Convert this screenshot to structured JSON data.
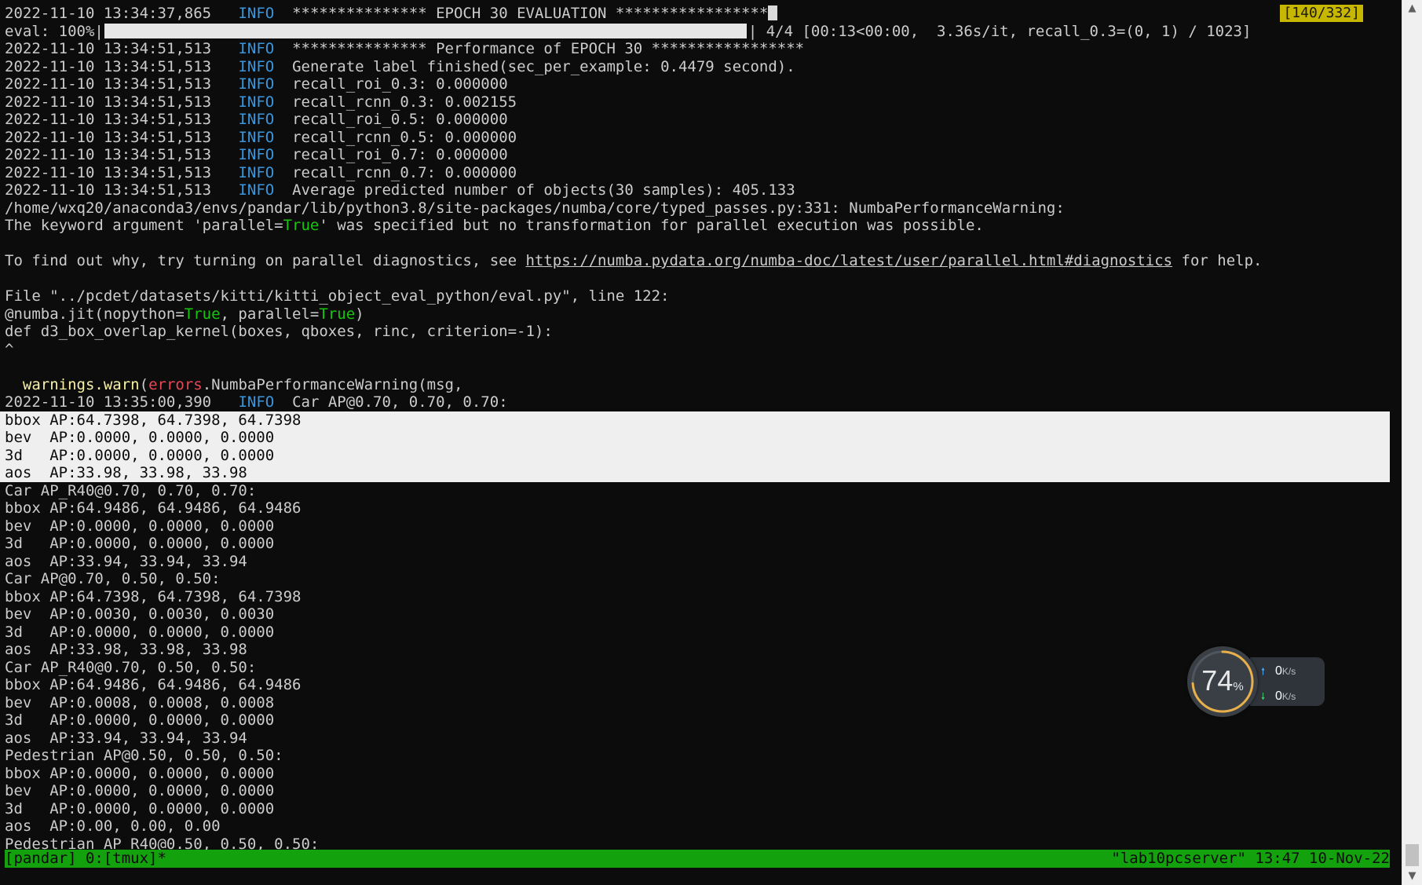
{
  "terminal": {
    "counter": "[140/332]",
    "lines": [
      {
        "t": "2022-11-10 13:34:37,865 ",
        "lvl": "INFO",
        "msg": "*************** EPOCH 30 EVALUATION *****************"
      },
      {
        "eval_prefix": "eval: 100%|",
        "eval_suffix": "| 4/4 [00:13<00:00,  3.36s/it, recall_0.3=(0, 1) / 1023]",
        "progress": 1.0
      },
      {
        "t": "2022-11-10 13:34:51,513 ",
        "lvl": "INFO",
        "msg": "*************** Performance of EPOCH 30 *****************"
      },
      {
        "t": "2022-11-10 13:34:51,513 ",
        "lvl": "INFO",
        "msg": "Generate label finished(sec_per_example: 0.4479 second)."
      },
      {
        "t": "2022-11-10 13:34:51,513 ",
        "lvl": "INFO",
        "msg": "recall_roi_0.3: 0.000000"
      },
      {
        "t": "2022-11-10 13:34:51,513 ",
        "lvl": "INFO",
        "msg": "recall_rcnn_0.3: 0.002155"
      },
      {
        "t": "2022-11-10 13:34:51,513 ",
        "lvl": "INFO",
        "msg": "recall_roi_0.5: 0.000000"
      },
      {
        "t": "2022-11-10 13:34:51,513 ",
        "lvl": "INFO",
        "msg": "recall_rcnn_0.5: 0.000000"
      },
      {
        "t": "2022-11-10 13:34:51,513 ",
        "lvl": "INFO",
        "msg": "recall_roi_0.7: 0.000000"
      },
      {
        "t": "2022-11-10 13:34:51,513 ",
        "lvl": "INFO",
        "msg": "recall_rcnn_0.7: 0.000000"
      },
      {
        "t": "2022-11-10 13:34:51,513 ",
        "lvl": "INFO",
        "msg": "Average predicted number of objects(30 samples): 405.133"
      },
      {
        "text": "/home/wxq20/anaconda3/envs/pandar/lib/python3.8/site-packages/numba/core/typed_passes.py:331: NumbaPerformanceWarning:"
      },
      {
        "parts": [
          [
            "The keyword argument 'parallel=",
            ""
          ],
          [
            "True",
            "green"
          ],
          [
            "' was specified but no transformation for parallel execution was possible.",
            ""
          ]
        ]
      },
      {
        "text": ""
      },
      {
        "parts": [
          [
            "To find out why, try turning on parallel diagnostics, see ",
            ""
          ],
          [
            "https://numba.pydata.org/numba-doc/latest/user/parallel.html#diagnostics",
            "link"
          ],
          [
            " for help.",
            ""
          ]
        ]
      },
      {
        "text": ""
      },
      {
        "text": "File \"../pcdet/datasets/kitti/kitti_object_eval_python/eval.py\", line 122:"
      },
      {
        "parts": [
          [
            "@numba.jit(nopython=",
            ""
          ],
          [
            "True",
            "green"
          ],
          [
            ", parallel=",
            ""
          ],
          [
            "True",
            "green"
          ],
          [
            ")",
            ""
          ]
        ]
      },
      {
        "text": "def d3_box_overlap_kernel(boxes, qboxes, rinc, criterion=-1):"
      },
      {
        "text": "^"
      },
      {
        "text": ""
      },
      {
        "parts": [
          [
            "  ",
            ""
          ],
          [
            "warnings.warn",
            "yellow"
          ],
          [
            "(",
            ""
          ],
          [
            "errors",
            "red"
          ],
          [
            ".NumbaPerformanceWarning(msg,",
            ""
          ]
        ]
      },
      {
        "t": "2022-11-10 13:35:00,390 ",
        "lvl": "INFO",
        "msg": "Car AP@0.70, 0.70, 0.70:"
      },
      {
        "parts": [
          [
            "bbox AP:",
            ""
          ],
          [
            "64.7398, 64.7398, 64.7398",
            "hi"
          ]
        ],
        "selected": true
      },
      {
        "text": "bev  AP:0.0000, 0.0000, 0.0000",
        "selected": true
      },
      {
        "text": "3d   AP:0.0000, 0.0000, 0.0000",
        "selected": true
      },
      {
        "text": "aos  AP:33.98, 33.98, 33.98",
        "selected": true
      },
      {
        "text": "Car AP_R40@0.70, 0.70, 0.70:"
      },
      {
        "text": "bbox AP:64.9486, 64.9486, 64.9486"
      },
      {
        "text": "bev  AP:0.0000, 0.0000, 0.0000"
      },
      {
        "text": "3d   AP:0.0000, 0.0000, 0.0000"
      },
      {
        "text": "aos  AP:33.94, 33.94, 33.94"
      },
      {
        "text": "Car AP@0.70, 0.50, 0.50:"
      },
      {
        "text": "bbox AP:64.7398, 64.7398, 64.7398"
      },
      {
        "text": "bev  AP:0.0030, 0.0030, 0.0030"
      },
      {
        "text": "3d   AP:0.0000, 0.0000, 0.0000"
      },
      {
        "text": "aos  AP:33.98, 33.98, 33.98"
      },
      {
        "text": "Car AP_R40@0.70, 0.50, 0.50:"
      },
      {
        "text": "bbox AP:64.9486, 64.9486, 64.9486"
      },
      {
        "text": "bev  AP:0.0008, 0.0008, 0.0008"
      },
      {
        "text": "3d   AP:0.0000, 0.0000, 0.0000"
      },
      {
        "text": "aos  AP:33.94, 33.94, 33.94"
      },
      {
        "text": "Pedestrian AP@0.50, 0.50, 0.50:"
      },
      {
        "text": "bbox AP:0.0000, 0.0000, 0.0000"
      },
      {
        "text": "bev  AP:0.0000, 0.0000, 0.0000"
      },
      {
        "text": "3d   AP:0.0000, 0.0000, 0.0000"
      },
      {
        "text": "aos  AP:0.00, 0.00, 0.00"
      },
      {
        "text": "Pedestrian AP_R40@0.50, 0.50, 0.50:"
      }
    ]
  },
  "status_bar": {
    "left": "[pandar] 0:[tmux]*",
    "right": "\"lab10pcserver\" 13:47 10-Nov-22"
  },
  "widget": {
    "cpu_value": "74",
    "cpu_unit": "%",
    "cpu_fraction": 0.74,
    "upload_value": "0",
    "download_value": "0",
    "rate_unit": "K/s"
  },
  "colors": {
    "background": "#0c0c0c",
    "text": "#cccccc",
    "info_level": "#3a96dd",
    "status_bar": "#13a10e",
    "counter": "#c8b700",
    "gauge_arc": "#e8b04a"
  }
}
